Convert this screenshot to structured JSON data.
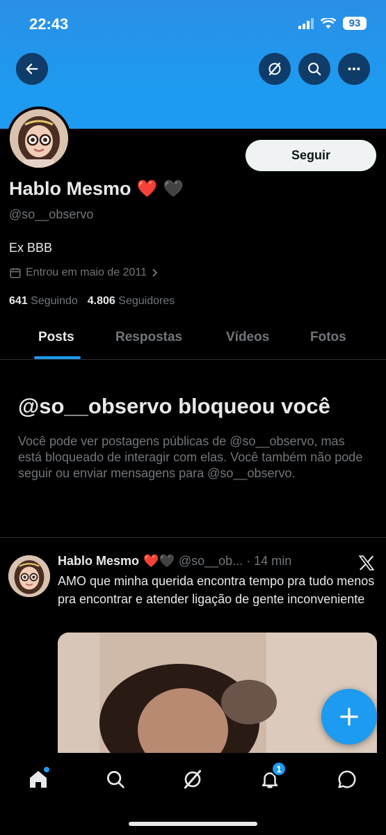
{
  "status_bar": {
    "time": "22:43",
    "battery": "93"
  },
  "header": {
    "back_icon": "arrow-left-icon",
    "grok_icon": "grok-icon",
    "search_icon": "search-icon",
    "more_icon": "more-icon"
  },
  "profile": {
    "follow_label": "Seguir",
    "name": "Hablo Mesmo",
    "name_emoji_1": "❤️",
    "name_emoji_2": "🖤",
    "handle": "@so__observo",
    "bio": "Ex BBB",
    "joined": "Entrou em maio de 2011",
    "following_count": "641",
    "following_label": "Seguindo",
    "followers_count": "4.806",
    "followers_label": "Seguidores"
  },
  "tabs": [
    {
      "label": "Posts",
      "active": true
    },
    {
      "label": "Respostas"
    },
    {
      "label": "Vídeos"
    },
    {
      "label": "Fotos"
    }
  ],
  "blocked": {
    "title": "@so__observo bloqueou você",
    "text": "Você pode ver postagens públicas de @so__observo, mas está bloqueado de interagir com elas. Você também não pode seguir ou enviar mensagens para @so__observo."
  },
  "tweet": {
    "name": "Hablo Mesmo",
    "emojis": "❤️🖤",
    "meta": "@so__ob... · 14 min",
    "text": "AMO que minha querida encontra tempo pra tudo menos pra encontrar e atender ligação de gente inconveniente"
  },
  "bottom_nav": {
    "notif_count": "1"
  },
  "colors": {
    "accent": "#1d9bf0",
    "background": "#000000",
    "muted": "#71767b"
  }
}
